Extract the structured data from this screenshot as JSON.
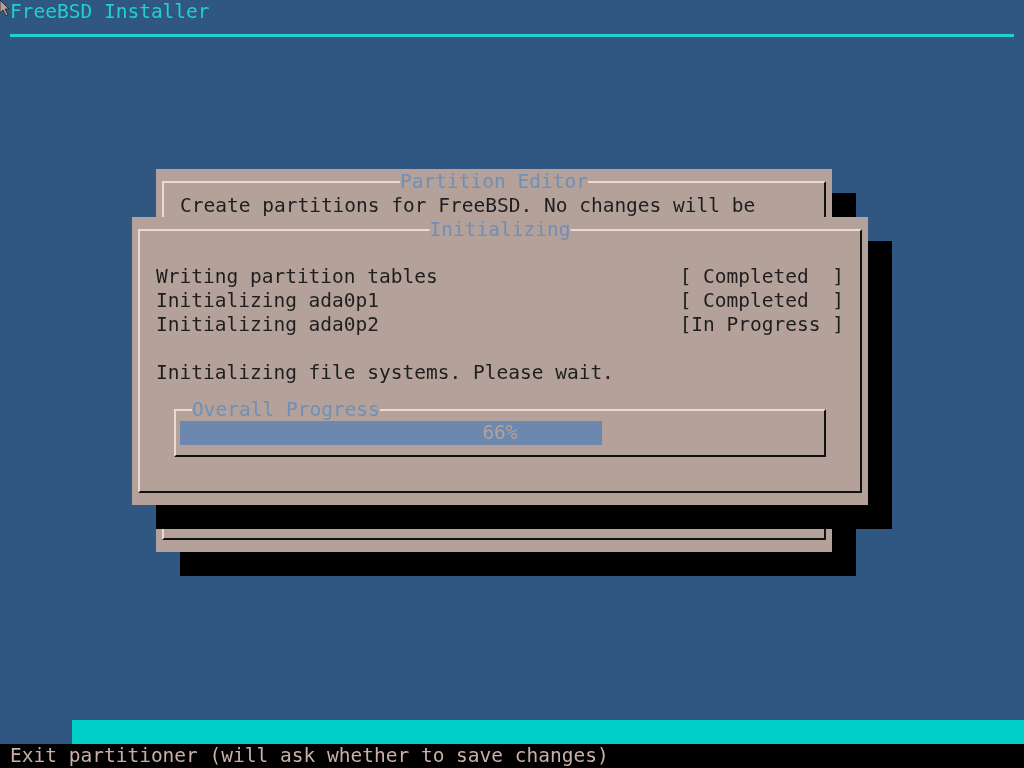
{
  "header": {
    "title": "FreeBSD Installer"
  },
  "background_dialog": {
    "title": "Partition Editor",
    "text": "Create partitions for FreeBSD. No changes will be"
  },
  "progress_dialog": {
    "title": "Initializing",
    "tasks": [
      {
        "name": "Writing partition tables",
        "status": "[ Completed  ]"
      },
      {
        "name": "Initializing ada0p1",
        "status": "[ Completed  ]"
      },
      {
        "name": "Initializing ada0p2",
        "status": "[In Progress ]"
      }
    ],
    "message": "Initializing file systems. Please wait.",
    "progress": {
      "title": "Overall Progress",
      "level": 0.66,
      "label": "66%"
    }
  },
  "status_bar": {
    "text": "Exit partitioner (will ask whether to save changes)"
  }
}
